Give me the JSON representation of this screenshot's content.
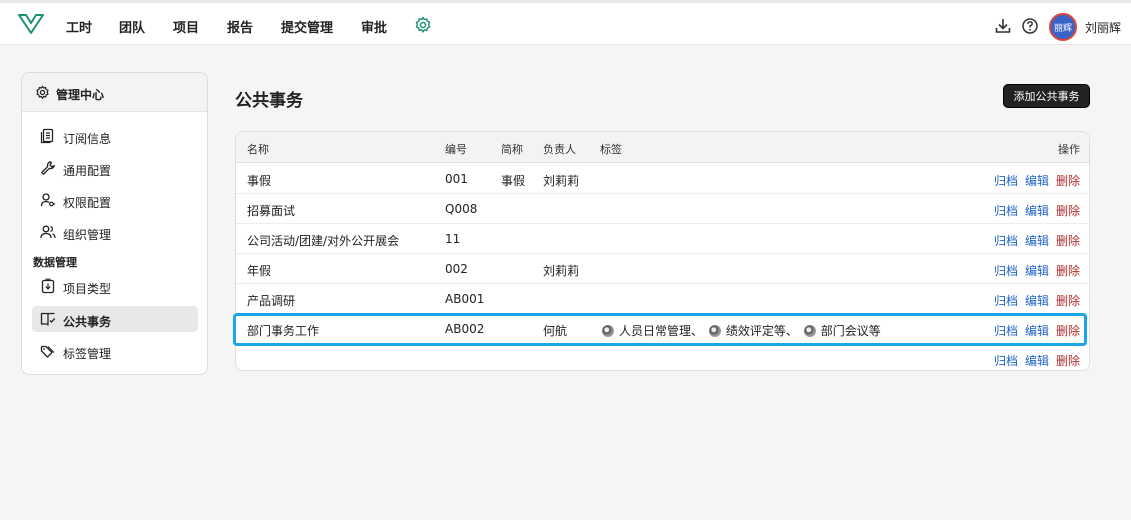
{
  "nav": {
    "items": [
      "工时",
      "团队",
      "项目",
      "报告",
      "提交管理",
      "审批"
    ],
    "user_name": "刘丽辉",
    "avatar_text": "丽辉"
  },
  "colors": {
    "accent": "#1aa7e8",
    "link": "#2064c8",
    "danger": "#b22c2c",
    "logo": "#1e8f74"
  },
  "sidebar": {
    "header": "管理中心",
    "items": [
      {
        "label": "订阅信息",
        "icon": "document-icon"
      },
      {
        "label": "通用配置",
        "icon": "wrench-icon"
      },
      {
        "label": "权限配置",
        "icon": "user-key-icon"
      },
      {
        "label": "组织管理",
        "icon": "users-icon"
      }
    ],
    "group_label": "数据管理",
    "data_items": [
      {
        "label": "项目类型",
        "icon": "project-type-icon"
      },
      {
        "label": "公共事务",
        "icon": "book-icon",
        "active": true
      },
      {
        "label": "标签管理",
        "icon": "tag-icon"
      }
    ]
  },
  "main": {
    "title": "公共事务",
    "add_button": "添加公共事务",
    "columns": {
      "name": "名称",
      "code": "编号",
      "short": "简称",
      "owner": "负责人",
      "tags": "标签",
      "ops": "操作"
    },
    "rows": [
      {
        "name": "事假",
        "code": "001",
        "short": "事假",
        "owner": "刘莉莉",
        "tags": []
      },
      {
        "name": "招募面试",
        "code": "Q008",
        "short": "",
        "owner": "",
        "tags": []
      },
      {
        "name": "公司活动/团建/对外公开展会",
        "code": "11",
        "short": "",
        "owner": "",
        "tags": []
      },
      {
        "name": "年假",
        "code": "002",
        "short": "",
        "owner": "刘莉莉",
        "tags": []
      },
      {
        "name": "产品调研",
        "code": "AB001",
        "short": "",
        "owner": "",
        "tags": []
      },
      {
        "name": "部门事务工作",
        "code": "AB002",
        "short": "",
        "owner": "何航",
        "tags": [
          "人员日常管理、",
          "绩效评定等、",
          "部门会议等"
        ]
      },
      {
        "name": "",
        "code": "",
        "short": "",
        "owner": "",
        "tags": []
      }
    ],
    "actions": {
      "archive": "归档",
      "edit": "编辑",
      "delete": "删除"
    }
  }
}
